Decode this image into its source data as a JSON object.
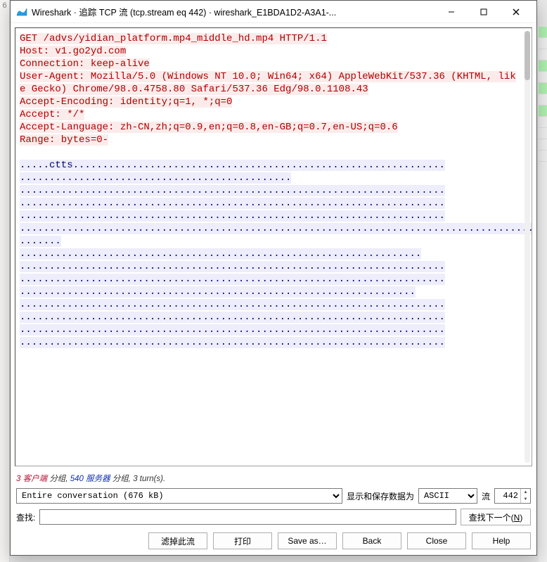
{
  "title": "Wireshark · 追踪 TCP 流 (tcp.stream eq 442) · wireshark_E1BDA1D2-A3A1-...",
  "request_lines": [
    "GET /advs/yidian_platform.mp4_middle_hd.mp4 HTTP/1.1",
    "Host: v1.go2yd.com",
    "Connection: keep-alive",
    "User-Agent: Mozilla/5.0 (Windows NT 10.0; Win64; x64) AppleWebKit/537.36 (KHTML, like Gecko) Chrome/98.0.4758.80 Safari/537.36 Edg/98.0.1108.43",
    "Accept-Encoding: identity;q=1, *;q=0",
    "Accept: */*",
    "Accept-Language: zh-CN,zh;q=0.9,en;q=0.8,en-GB;q=0.7,en-US;q=0.6",
    "Range: bytes=0-"
  ],
  "response_segments": [
    ".....ctts...............................................................",
    "..............................................",
    "........................................................................",
    "........................................................................",
    "........................................................................",
    "................................................................................................................................................",
    ".......",
    "....................................................................",
    "........................................................................",
    "........................................................................",
    "...................................................................",
    "........................................................................",
    "........................................................................",
    "........................................................................",
    "........................................................................"
  ],
  "stats": {
    "client_packets": "3",
    "client_label": "客户端",
    "server_packets": "540",
    "server_label": "服务器",
    "packets_word": "分组",
    "turns": "3 turn(s)."
  },
  "conversation": {
    "combo_value": "Entire conversation (676 kB)",
    "show_as_label": "显示和保存数据为",
    "encoding": "ASCII",
    "stream_label": "流",
    "stream_value": "442"
  },
  "search": {
    "label": "查找:",
    "placeholder": "",
    "find_next": "查找下一个(N)"
  },
  "buttons": {
    "filter_out": "滤掉此流",
    "print": "打印",
    "save_as": "Save as…",
    "back": "Back",
    "close": "Close",
    "help": "Help"
  }
}
